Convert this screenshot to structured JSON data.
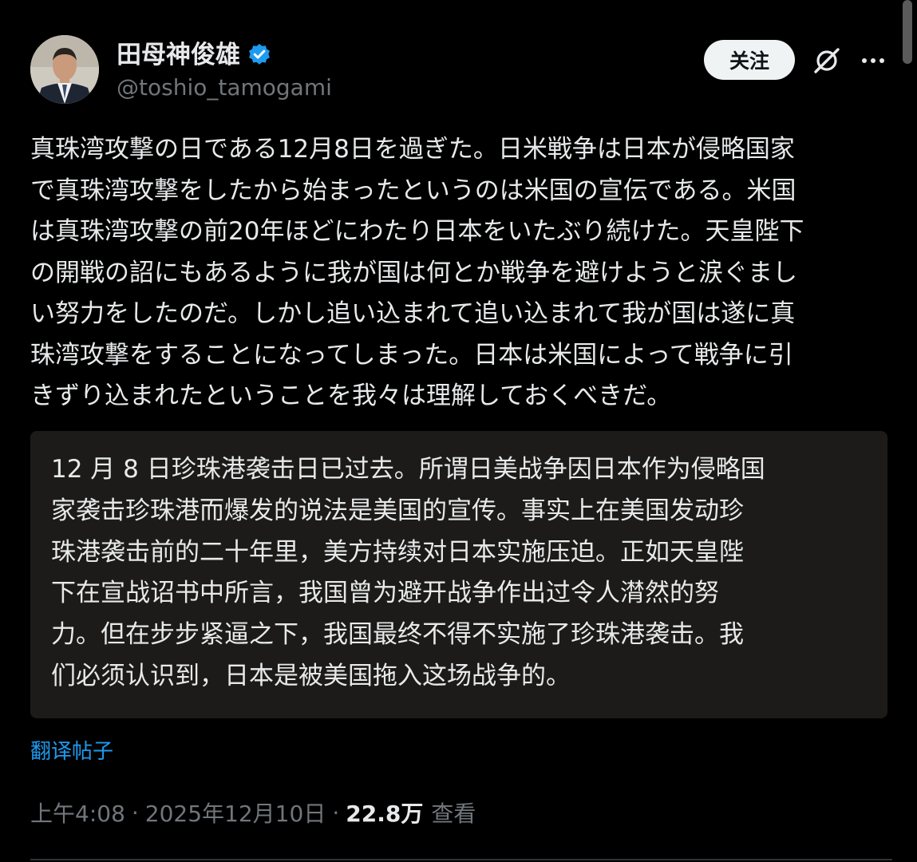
{
  "author": {
    "display_name": "田母神俊雄",
    "handle": "@toshio_tamogami",
    "verified_icon": "verified-badge-icon"
  },
  "actions": {
    "follow_label": "关注",
    "grok_icon": "grok-slash-icon",
    "more_icon": "more-horizontal-icon"
  },
  "post": {
    "text": "真珠湾攻撃の日である12月8日を過ぎた。日米戦争は日本が侵略国家\nで真珠湾攻撃をしたから始まったというのは米国の宣伝である。米国\nは真珠湾攻撃の前20年ほどにわたり日本をいたぶり続けた。天皇陛下\nの開戦の詔にもあるように我が国は何とか戦争を避けようと涙ぐまし\nい努力をしたのだ。しかし追い込まれて追い込まれて我が国は遂に真\n珠湾攻撃をすることになってしまった。日本は米国によって戦争に引\nきずり込まれたということを我々は理解しておくべきだ。",
    "translation": "12 月 8 日珍珠港袭击日已过去。所谓日美战争因日本作为侵略国\n家袭击珍珠港而爆发的说法是美国的宣传。事实上在美国发动珍\n珠港袭击前的二十年里，美方持续对日本实施压迫。正如天皇陛\n下在宣战诏书中所言，我国曾为避开战争作出过令人潸然的努\n力。但在步步紧逼之下，我国最终不得不实施了珍珠港袭击。我\n们必须认识到，日本是被美国拖入这场战争的。",
    "translate_link": "翻译帖子"
  },
  "meta": {
    "time": "上午4:08",
    "separator": "·",
    "date": "2025年12月10日",
    "views_count": "22.8万",
    "views_label": "查看"
  },
  "colors": {
    "background": "#000000",
    "text": "#e7e9ea",
    "secondary": "#71767b",
    "accent": "#1d9bf0",
    "translation_bg": "#1c1b19",
    "follow_bg": "#eff3f4"
  }
}
